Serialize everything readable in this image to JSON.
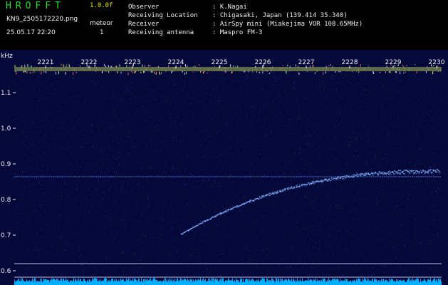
{
  "header": {
    "app_title": "HROFFT",
    "version": "1.0.0f",
    "filename": "KN9_2505172220.png",
    "timestamp": "25.05.17 22:20",
    "meteor_label": "meteor",
    "meteor_count": "1"
  },
  "metadata": [
    {
      "key": "Observer",
      "value": ": K.Nagai"
    },
    {
      "key": "Receiving Location",
      "value": ": Chigasaki, Japan (139.414 35.340)"
    },
    {
      "key": "Receiver",
      "value": ": AirSpy mini (Miakejima VOR 108.65MHz)"
    },
    {
      "key": "Receiving antenna",
      "value": ": Maspro FM-3"
    }
  ],
  "axes": {
    "unit_label": "kHz",
    "x_ticks": [
      "2221",
      "2222",
      "2223",
      "2224",
      "2225",
      "2226",
      "2227",
      "2228",
      "2229",
      "2230"
    ],
    "y_ticks": [
      "1.1",
      "1.0",
      "0.9",
      "0.8",
      "0.7",
      "0.6"
    ]
  },
  "colors": {
    "background": "#05093a",
    "noise": "#2a40b0",
    "signal": "#7fb0ff",
    "bottom_band": "#00b0ff"
  }
}
